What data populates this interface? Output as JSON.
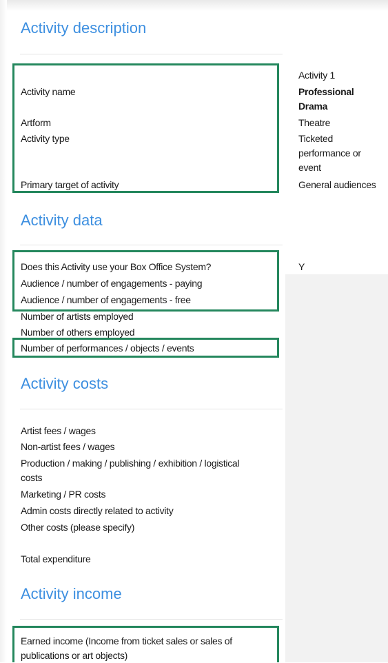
{
  "sections": {
    "description": {
      "title": "Activity description",
      "labels": {
        "activity_name": "Activity name",
        "artform": "Artform",
        "activity_type": "Activity type",
        "primary_target": "Primary target of activity"
      },
      "values": {
        "activity_number": "Activity 1",
        "activity_name": "Professional\nDrama",
        "artform": "Theatre",
        "activity_type": "Ticketed\nperformance or\nevent",
        "primary_target": "General audiences"
      }
    },
    "data": {
      "title": "Activity data",
      "labels": {
        "box_office": "Does this Activity use your Box Office System?",
        "paying": "Audience / number of engagements - paying",
        "free": "Audience / number of engagements - free",
        "artists": "Number of artists employed",
        "others": "Number of others employed",
        "performances": "Number of performances / objects / events"
      },
      "values": {
        "box_office": "Y"
      }
    },
    "costs": {
      "title": "Activity costs",
      "labels": {
        "artist_fees": "Artist fees / wages",
        "non_artist_fees": "Non-artist fees / wages",
        "production": "Production / making / publishing / exhibition / logistical\ncosts",
        "marketing": "Marketing / PR costs",
        "admin": "Admin costs directly related to activity",
        "other": "Other costs (please specify)",
        "total": "Total expenditure"
      }
    },
    "income": {
      "title": "Activity income",
      "labels": {
        "earned": "Earned income (Income from ticket sales or sales of\npublications or art objects)"
      }
    }
  },
  "colors": {
    "section_title": "#3d8fe0",
    "highlight_border": "#24875d",
    "divider": "#e4e4e4",
    "value_panel": "#f2f2f2"
  }
}
